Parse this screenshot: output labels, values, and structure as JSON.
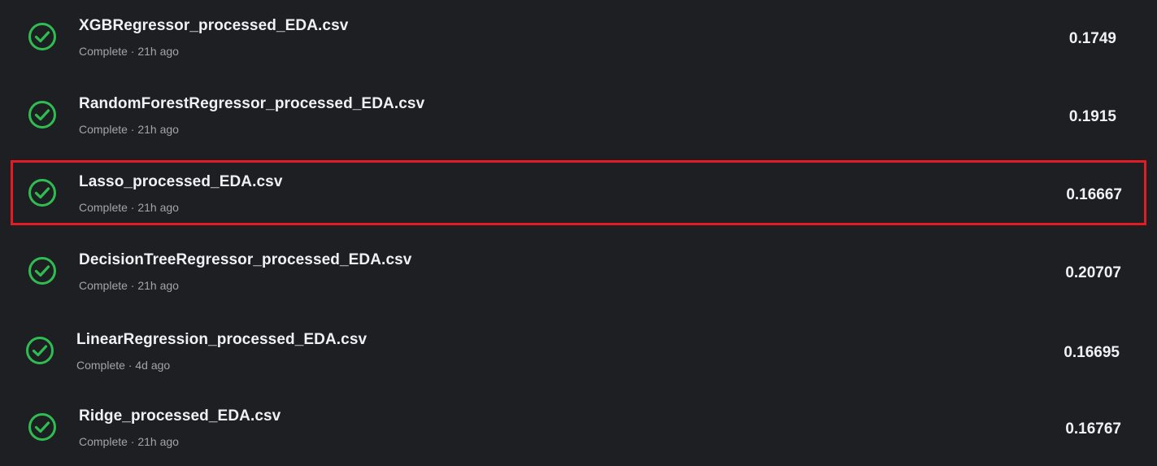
{
  "submissions": [
    {
      "filename": "XGBRegressor_processed_EDA.csv",
      "status": "Complete",
      "age": "21h ago",
      "meta": "Complete · 21h ago",
      "score": "0.1749",
      "icon": "check-circle-icon"
    },
    {
      "filename": "RandomForestRegressor_processed_EDA.csv",
      "status": "Complete",
      "age": "21h ago",
      "meta": "Complete · 21h ago",
      "score": "0.1915",
      "icon": "check-circle-icon"
    },
    {
      "filename": "Lasso_processed_EDA.csv",
      "status": "Complete",
      "age": "21h ago",
      "meta": "Complete · 21h ago",
      "score": "0.16667",
      "icon": "check-circle-icon",
      "highlighted": true
    },
    {
      "filename": "DecisionTreeRegressor_processed_EDA.csv",
      "status": "Complete",
      "age": "21h ago",
      "meta": "Complete · 21h ago",
      "score": "0.20707",
      "icon": "check-circle-icon"
    },
    {
      "filename": "LinearRegression_processed_EDA.csv",
      "status": "Complete",
      "age": "4d ago",
      "meta": "Complete · 4d ago",
      "score": "0.16695",
      "icon": "check-circle-icon"
    },
    {
      "filename": "Ridge_processed_EDA.csv",
      "status": "Complete",
      "age": "21h ago",
      "meta": "Complete · 21h ago",
      "score": "0.16767",
      "icon": "check-circle-icon"
    }
  ],
  "colors": {
    "background": "#1e1f22",
    "success_green": "#2fbd52",
    "highlight_border": "#e31b23",
    "primary_text": "#f1f1f3",
    "secondary_text": "#a3a4a8"
  }
}
